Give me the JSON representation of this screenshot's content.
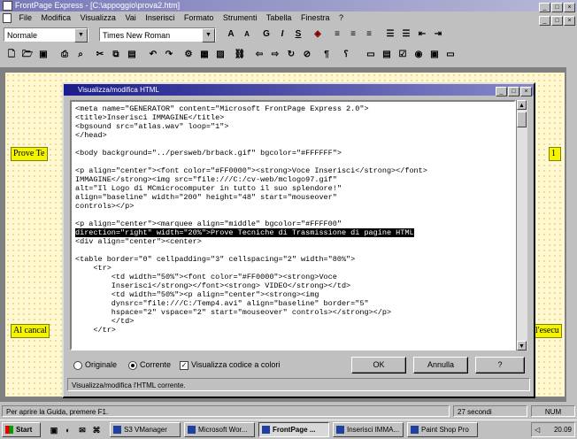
{
  "app": {
    "title": "FrontPage Express - [C:\\appoggio\\prova2.htm]",
    "menu": [
      "File",
      "Modifica",
      "Visualizza",
      "Vai",
      "Inserisci",
      "Formato",
      "Strumenti",
      "Tabella",
      "Finestra",
      "?"
    ]
  },
  "format_toolbar": {
    "style": "Normale",
    "font": "Times New Roman",
    "buttons": [
      "A",
      "A",
      "G",
      "I",
      "S"
    ]
  },
  "page": {
    "text1": "Prove Te",
    "text2": "Al cancal",
    "text3": "l'esecu",
    "marker": "1"
  },
  "dialog": {
    "title": "Visualizza/modifica HTML",
    "code_lines": [
      "<meta name=\"GENERATOR\" content=\"Microsoft FrontPage Express 2.0\">",
      "<title>Inserisci IMMAGINE</title>",
      "<bgsound src=\"atlas.wav\" loop=\"1\">",
      "</head>",
      "",
      "<body background=\"../persweb/brback.gif\" bgcolor=\"#FFFFFF\">",
      "",
      "<p align=\"center\"><font color=\"#FF0000\"><strong>Voce Inserisci</strong></font>",
      "IMMAGINE</strong><img src=\"file:///C:/cv-web/mclogo97.gif\"",
      "alt=\"Il Logo di MCmicrocomputer in tutto il suo splendore!\"",
      "align=\"baseline\" width=\"200\" height=\"48\" start=\"mouseover\"",
      "controls></p>",
      "",
      "<p align=\"center\"><marquee align=\"middle\" bgcolor=\"#FFFF00\"",
      "direction=\"right\" width=\"20%\">Prove Tecniche di Trasmissione di pagine HTML",
      "<div align=\"center\"><center>",
      "",
      "<table border=\"0\" cellpadding=\"3\" cellspacing=\"2\" width=\"80%\">",
      "    <tr>",
      "        <td width=\"50%\"><font color=\"#FF0000\"><strong>Voce",
      "        Inserisci</strong></font><strong> VIDEO</strong></td>",
      "        <td width=\"50%\"><p align=\"center\"><strong><img",
      "        dynsrc=\"file:///C:/Temp4.avi\" align=\"baseline\" border=\"5\"",
      "        hspace=\"2\" vspace=\"2\" start=\"mouseover\" controls></strong></p>",
      "        </td>",
      "    </tr>"
    ],
    "radio_original": "Originale",
    "radio_current": "Corrente",
    "check_colors": "Visualizza codice a colori",
    "ok": "OK",
    "cancel": "Annulla",
    "help": "?",
    "status": "Visualizza/modifica l'HTML corrente."
  },
  "statusbar": {
    "help": "Per aprire la Guida, premere F1.",
    "time": "27 secondi",
    "num": "NUM"
  },
  "taskbar": {
    "start": "Start",
    "tasks": [
      "S3 VManager",
      "Microsoft Wor...",
      "FrontPage ...",
      "Inserisci IMMA...",
      "Paint Shop Pro"
    ],
    "clock": "20.09"
  },
  "colors": {
    "highlight": "#f4f400",
    "title_active": "#1c1c8c"
  }
}
